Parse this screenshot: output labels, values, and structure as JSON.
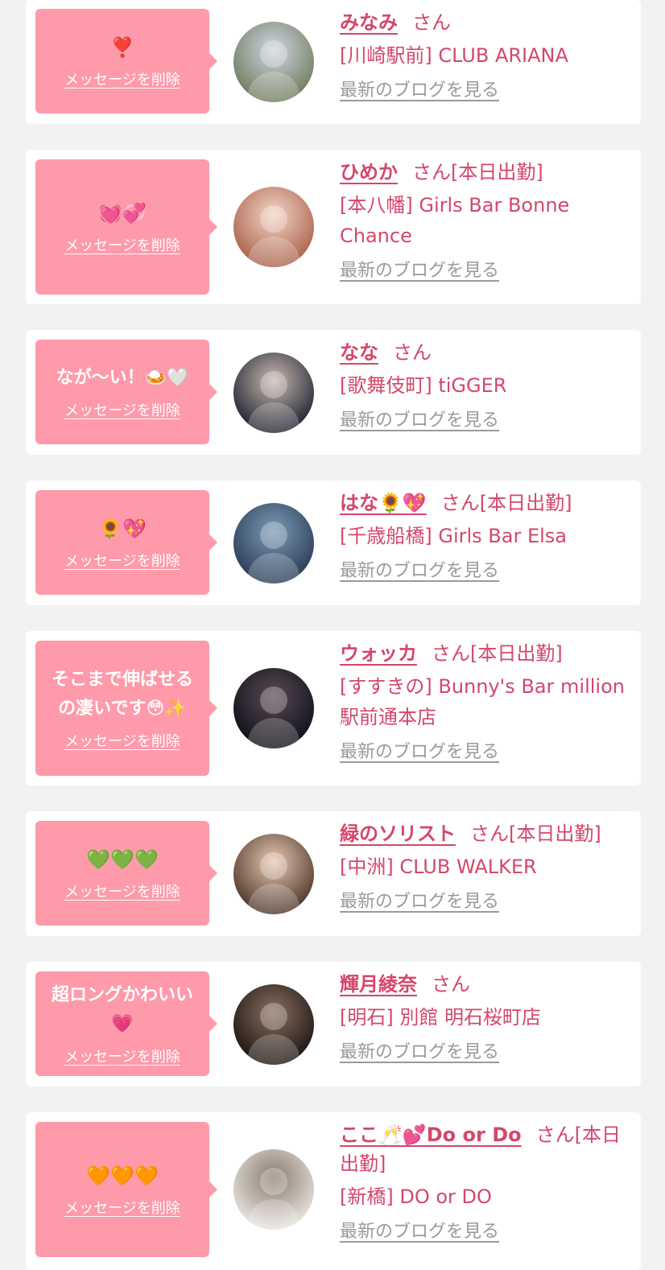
{
  "delete_label": "メッセージを削除",
  "blog_label": "最新のブログを見る",
  "suffix_san": "さん",
  "entries": [
    {
      "message": "❣️",
      "message_type": "emoji",
      "name": "みなみ",
      "suffix": "さん",
      "shop": "[川崎駅前] CLUB ARIANA",
      "avatar": {
        "from": "#6e7a5a",
        "to": "#cfd6e3",
        "icon": "person-photo"
      }
    },
    {
      "message": "💓💞",
      "message_type": "emoji",
      "name": "ひめか",
      "suffix": "さん[本日出勤]",
      "shop": "[本八幡] Girls Bar Bonne Chance",
      "avatar": {
        "from": "#a8604a",
        "to": "#f3d4c6",
        "icon": "person-photo"
      }
    },
    {
      "message": "なが〜い！🍛🤍",
      "message_type": "text",
      "name": "なな",
      "suffix": "さん",
      "shop": "[歌舞伎町] tiGGER",
      "avatar": {
        "from": "#1d2130",
        "to": "#c9b9b0",
        "icon": "person-photo"
      }
    },
    {
      "message": "🌻💖",
      "message_type": "emoji",
      "name": "はな🌻💖",
      "suffix": "さん[本日出勤]",
      "shop": "[千歳船橋] Girls Bar Elsa",
      "avatar": {
        "from": "#2a3a55",
        "to": "#7a9bb5",
        "icon": "person-photo"
      }
    },
    {
      "message": "そこまで伸ばせる\nの凄いです😳✨",
      "message_type": "text",
      "name": "ウォッカ",
      "suffix": "さん[本日出勤]",
      "shop": "[すすきの] Bunny's Bar million 駅前通本店",
      "avatar": {
        "from": "#0e0f17",
        "to": "#5a4a55",
        "icon": "person-photo"
      }
    },
    {
      "message": "💚💚💚",
      "message_type": "emoji",
      "name": "緑のソリスト",
      "suffix": "さん[本日出勤]",
      "shop": "[中洲] CLUB WALKER",
      "avatar": {
        "from": "#4a3326",
        "to": "#e8c9b4",
        "icon": "person-photo"
      }
    },
    {
      "message": "超ロングかわいい\n💗",
      "message_type": "text",
      "name": "輝月綾奈",
      "suffix": "さん",
      "shop": "[明石] 別館 明石桜町店",
      "avatar": {
        "from": "#1a1412",
        "to": "#8a6f5e",
        "icon": "person-photo"
      }
    },
    {
      "message": "🧡🧡🧡",
      "message_type": "emoji",
      "name": "ここ🥂💕Do or Do",
      "suffix": "さん[本日出勤]",
      "shop": "[新橋] DO or DO",
      "avatar": {
        "from": "#e9e6e1",
        "to": "#8a7c70",
        "icon": "person-photo"
      }
    }
  ]
}
